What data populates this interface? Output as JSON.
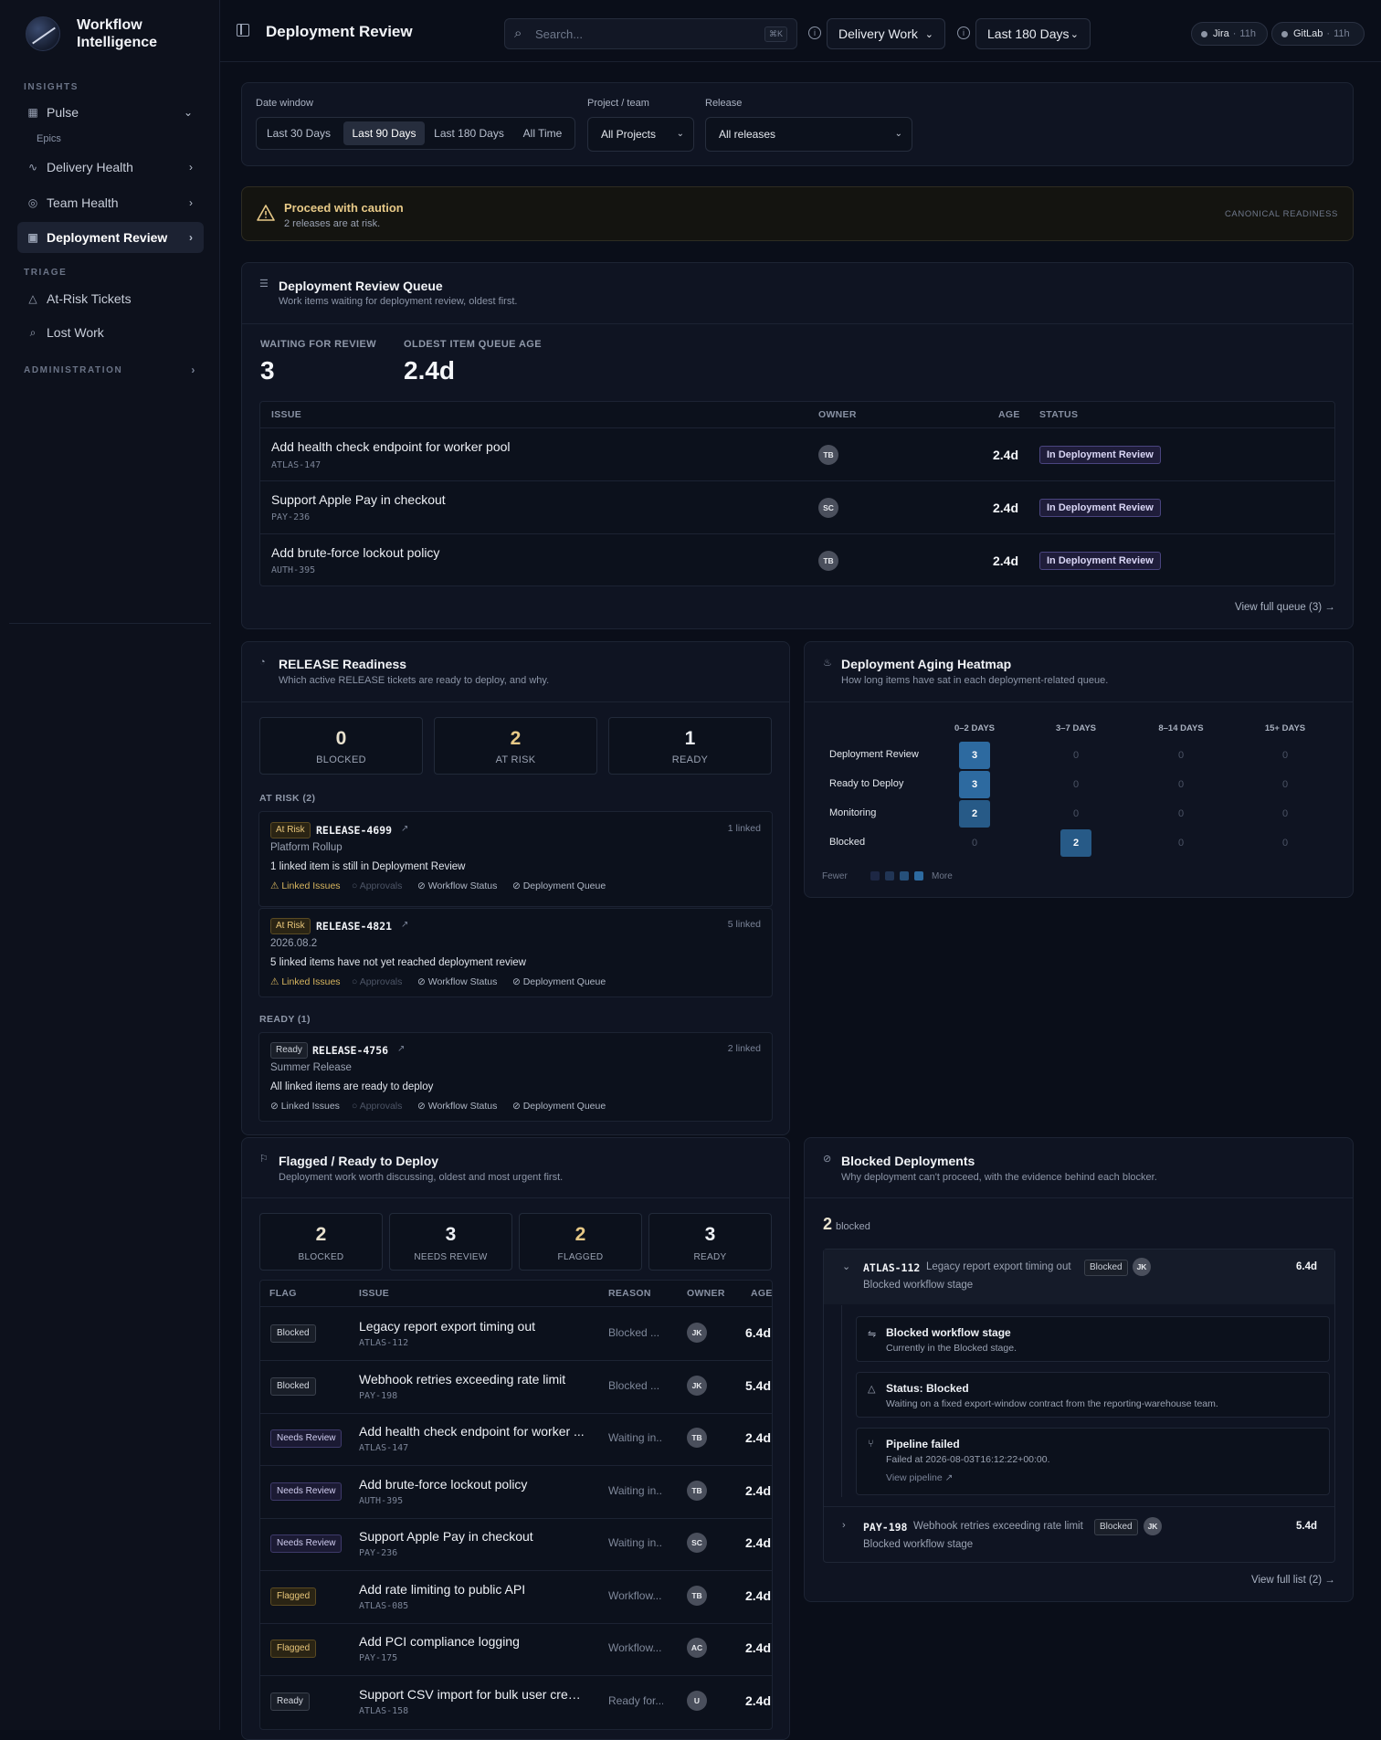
{
  "app": {
    "name_line1": "Workflow",
    "name_line2": "Intelligence"
  },
  "sidebar": {
    "insights_label": "INSIGHTS",
    "triage_label": "TRIAGE",
    "admin_label": "ADMINISTRATION",
    "items": [
      {
        "label": "Pulse",
        "icon": "grid-icon"
      },
      {
        "label": "Delivery Health",
        "icon": "pulse-icon"
      },
      {
        "label": "Team Health",
        "icon": "team-icon"
      },
      {
        "label": "Deployment Review",
        "icon": "clipboard-icon"
      }
    ],
    "pulse_sub": "Epics",
    "triage_items": [
      {
        "label": "At-Risk Tickets",
        "icon": "warning-icon"
      },
      {
        "label": "Lost Work",
        "icon": "search-icon"
      }
    ]
  },
  "topbar": {
    "title": "Deployment Review",
    "search_placeholder": "Search...",
    "search_shortcut": "⌘K",
    "work_select": "Delivery Work",
    "range_select": "Last 180 Days",
    "sources": [
      {
        "name": "Jira",
        "age": "11h"
      },
      {
        "name": "GitLab",
        "age": "11h"
      }
    ]
  },
  "filters": {
    "date_label": "Date window",
    "date_options": [
      "Last 30 Days",
      "Last 90 Days",
      "Last 180 Days",
      "All Time"
    ],
    "date_selected": "Last 90 Days",
    "project_label": "Project / team",
    "project_value": "All Projects",
    "release_label": "Release",
    "release_value": "All releases"
  },
  "alert": {
    "title": "Proceed with caution",
    "message": "2 releases are at risk.",
    "tag": "CANONICAL READINESS"
  },
  "queue": {
    "title": "Deployment Review Queue",
    "subtitle": "Work items waiting for deployment review, oldest first.",
    "waiting_label": "WAITING FOR REVIEW",
    "waiting_value": "3",
    "oldest_label": "OLDEST ITEM QUEUE AGE",
    "oldest_value": "2.4d",
    "columns": [
      "ISSUE",
      "OWNER",
      "AGE",
      "STATUS"
    ],
    "rows": [
      {
        "title": "Add health check endpoint for worker pool",
        "key": "ATLAS-147",
        "owner": "TB",
        "age": "2.4d",
        "status": "In Deployment Review"
      },
      {
        "title": "Support Apple Pay in checkout",
        "key": "PAY-236",
        "owner": "SC",
        "age": "2.4d",
        "status": "In Deployment Review"
      },
      {
        "title": "Add brute-force lockout policy",
        "key": "AUTH-395",
        "owner": "TB",
        "age": "2.4d",
        "status": "In Deployment Review"
      }
    ],
    "link": "View full queue (3) →"
  },
  "readiness": {
    "title": "RELEASE Readiness",
    "subtitle": "Which active RELEASE tickets are ready to deploy, and why.",
    "stats": [
      {
        "value": "0",
        "label": "BLOCKED",
        "color": "#e9e2cf"
      },
      {
        "value": "2",
        "label": "AT RISK",
        "color": "#e7c987"
      },
      {
        "value": "1",
        "label": "READY",
        "color": "#eef1f6"
      }
    ],
    "at_risk_label": "AT RISK (2)",
    "ready_label": "READY (1)",
    "releases": [
      {
        "tag": "At Risk",
        "id": "RELEASE-4699",
        "linked": "1 linked",
        "name": "Platform Rollup",
        "desc": "1 linked item is still in Deployment Review",
        "checks": [
          "Linked Issues",
          "Approvals",
          "Workflow Status",
          "Deployment Queue"
        ]
      },
      {
        "tag": "At Risk",
        "id": "RELEASE-4821",
        "linked": "5 linked",
        "name": "2026.08.2",
        "desc": "5 linked items have not yet reached deployment review",
        "checks": [
          "Linked Issues",
          "Approvals",
          "Workflow Status",
          "Deployment Queue"
        ]
      },
      {
        "tag": "Ready",
        "id": "RELEASE-4756",
        "linked": "2 linked",
        "name": "Summer Release",
        "desc": "All linked items are ready to deploy",
        "checks": [
          "Linked Issues",
          "Approvals",
          "Workflow Status",
          "Deployment Queue"
        ]
      }
    ]
  },
  "heatmap": {
    "title": "Deployment Aging Heatmap",
    "subtitle": "How long items have sat in each deployment-related queue.",
    "columns": [
      "0–2 DAYS",
      "3–7 DAYS",
      "8–14 DAYS",
      "15+ DAYS"
    ],
    "rows": [
      {
        "label": "Deployment Review",
        "values": [
          3,
          0,
          0,
          0
        ]
      },
      {
        "label": "Ready to Deploy",
        "values": [
          3,
          0,
          0,
          0
        ]
      },
      {
        "label": "Monitoring",
        "values": [
          2,
          0,
          0,
          0
        ]
      },
      {
        "label": "Blocked",
        "values": [
          0,
          2,
          0,
          0
        ]
      }
    ],
    "legend_fewer": "Fewer",
    "legend_more": "More"
  },
  "flagged": {
    "title": "Flagged / Ready to Deploy",
    "subtitle": "Deployment work worth discussing, oldest and most urgent first.",
    "stats": [
      {
        "value": "2",
        "label": "BLOCKED",
        "color": "#e9e2cf"
      },
      {
        "value": "3",
        "label": "NEEDS REVIEW",
        "color": "#eef1f6"
      },
      {
        "value": "2",
        "label": "FLAGGED",
        "color": "#e7c987"
      },
      {
        "value": "3",
        "label": "READY",
        "color": "#eef1f6"
      }
    ],
    "columns": [
      "FLAG",
      "ISSUE",
      "REASON",
      "OWNER",
      "AGE"
    ],
    "rows": [
      {
        "flag": "Blocked",
        "kind": "blocked",
        "title": "Legacy report export timing out",
        "key": "ATLAS-112",
        "reason": "Blocked ...",
        "owner": "JK",
        "age": "6.4d"
      },
      {
        "flag": "Blocked",
        "kind": "blocked",
        "title": "Webhook retries exceeding rate limit",
        "key": "PAY-198",
        "reason": "Blocked ...",
        "owner": "JK",
        "age": "5.4d"
      },
      {
        "flag": "Needs Review",
        "kind": "review",
        "title": "Add health check endpoint for worker ...",
        "key": "ATLAS-147",
        "reason": "Waiting in...",
        "owner": "TB",
        "age": "2.4d"
      },
      {
        "flag": "Needs Review",
        "kind": "review",
        "title": "Add brute-force lockout policy",
        "key": "AUTH-395",
        "reason": "Waiting in...",
        "owner": "TB",
        "age": "2.4d"
      },
      {
        "flag": "Needs Review",
        "kind": "review",
        "title": "Support Apple Pay in checkout",
        "key": "PAY-236",
        "reason": "Waiting in...",
        "owner": "SC",
        "age": "2.4d"
      },
      {
        "flag": "Flagged",
        "kind": "flag",
        "title": "Add rate limiting to public API",
        "key": "ATLAS-085",
        "reason": "Workflow...",
        "owner": "TB",
        "age": "2.4d"
      },
      {
        "flag": "Flagged",
        "kind": "flag",
        "title": "Add PCI compliance logging",
        "key": "PAY-175",
        "reason": "Workflow...",
        "owner": "AC",
        "age": "2.4d"
      },
      {
        "flag": "Ready",
        "kind": "ready",
        "title": "Support CSV import for bulk user creat...",
        "key": "ATLAS-158",
        "reason": "Ready for...",
        "owner": "U",
        "age": "2.4d"
      }
    ]
  },
  "blocked": {
    "title": "Blocked Deployments",
    "subtitle": "Why deployment can't proceed, with the evidence behind each blocker.",
    "count": "2",
    "count_label": "blocked",
    "items": [
      {
        "key": "ATLAS-112",
        "title": "Legacy report export timing out",
        "badge": "Blocked",
        "owner": "JK",
        "age": "6.4d",
        "stage": "Blocked workflow stage"
      },
      {
        "key": "PAY-198",
        "title": "Webhook retries exceeding rate limit",
        "badge": "Blocked",
        "owner": "JK",
        "age": "5.4d",
        "stage": "Blocked workflow stage"
      }
    ],
    "evidence": [
      {
        "title": "Blocked workflow stage",
        "detail": "Currently in the Blocked stage."
      },
      {
        "title": "Status: Blocked",
        "detail": "Waiting on a fixed export-window contract from the reporting-warehouse team."
      },
      {
        "title": "Pipeline failed",
        "detail": "Failed at 2026-08-03T16:12:22+00:00.",
        "link": "View pipeline"
      }
    ],
    "link": "View full list (2) →"
  }
}
